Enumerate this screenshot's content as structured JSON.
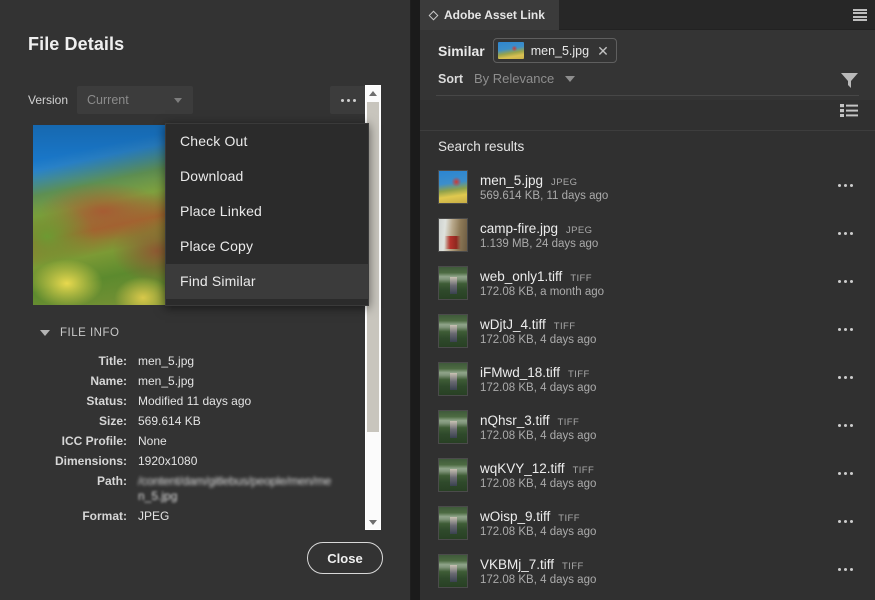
{
  "file_details": {
    "title": "File Details",
    "version_label": "Version",
    "version_value": "Current",
    "overflow_icon": "ellipsis-icon",
    "close_label": "Close",
    "file_info_section_label": "FILE INFO",
    "fields": [
      {
        "key": "Title:",
        "value": "men_5.jpg"
      },
      {
        "key": "Name:",
        "value": "men_5.jpg"
      },
      {
        "key": "Status:",
        "value": "Modified 11 days ago"
      },
      {
        "key": "Size:",
        "value": "569.614 KB"
      },
      {
        "key": "ICC Profile:",
        "value": "None"
      },
      {
        "key": "Dimensions:",
        "value": "1920x1080"
      },
      {
        "key": "Path:",
        "value": "/content/dam/gitlebus/people/men/me",
        "value2": "n_5.jpg"
      },
      {
        "key": "Format:",
        "value": "JPEG"
      }
    ]
  },
  "context_menu": {
    "items": [
      {
        "label": "Check Out",
        "highlighted": false
      },
      {
        "label": "Download",
        "highlighted": false
      },
      {
        "label": "Place Linked",
        "highlighted": false
      },
      {
        "label": "Place Copy",
        "highlighted": false
      },
      {
        "label": "Find Similar",
        "highlighted": true
      }
    ]
  },
  "asset_link": {
    "tab_label": "Adobe Asset Link",
    "panel_menu_icon": "hamburger-icon",
    "similar_label": "Similar",
    "chip_name": "men_5.jpg",
    "chip_remove_icon": "close-icon",
    "sort_label": "Sort",
    "sort_value": "By Relevance",
    "filter_icon": "funnel-icon",
    "list_view_icon": "list-view-icon",
    "results_title": "Search results",
    "results": [
      {
        "name": "men_5.jpg",
        "format": "JPEG",
        "meta": "569.614 KB, 11 days ago",
        "thumb": "t-men"
      },
      {
        "name": "camp-fire.jpg",
        "format": "JPEG",
        "meta": "1.139 MB, 24 days ago",
        "thumb": "t-camp"
      },
      {
        "name": "web_only1.tiff",
        "format": "TIFF",
        "meta": "172.08 KB, a month ago",
        "thumb": "t-web"
      },
      {
        "name": "wDjtJ_4.tiff",
        "format": "TIFF",
        "meta": "172.08 KB, 4 days ago",
        "thumb": "t-web"
      },
      {
        "name": "iFMwd_18.tiff",
        "format": "TIFF",
        "meta": "172.08 KB, 4 days ago",
        "thumb": "t-web"
      },
      {
        "name": "nQhsr_3.tiff",
        "format": "TIFF",
        "meta": "172.08 KB, 4 days ago",
        "thumb": "t-web"
      },
      {
        "name": "wqKVY_12.tiff",
        "format": "TIFF",
        "meta": "172.08 KB, 4 days ago",
        "thumb": "t-web"
      },
      {
        "name": "wOisp_9.tiff",
        "format": "TIFF",
        "meta": "172.08 KB, 4 days ago",
        "thumb": "t-web"
      },
      {
        "name": "VKBMj_7.tiff",
        "format": "TIFF",
        "meta": "172.08 KB, 4 days ago",
        "thumb": "t-web"
      }
    ]
  },
  "colors": {
    "panel_bg": "#333333",
    "right_panel_bg": "#303030",
    "menu_bg": "#2b2b2b",
    "menu_highlight": "#3b3b3b",
    "text_primary": "#ededed",
    "text_muted": "#ababab",
    "scrollbar_thumb": "#c8c5bd"
  }
}
